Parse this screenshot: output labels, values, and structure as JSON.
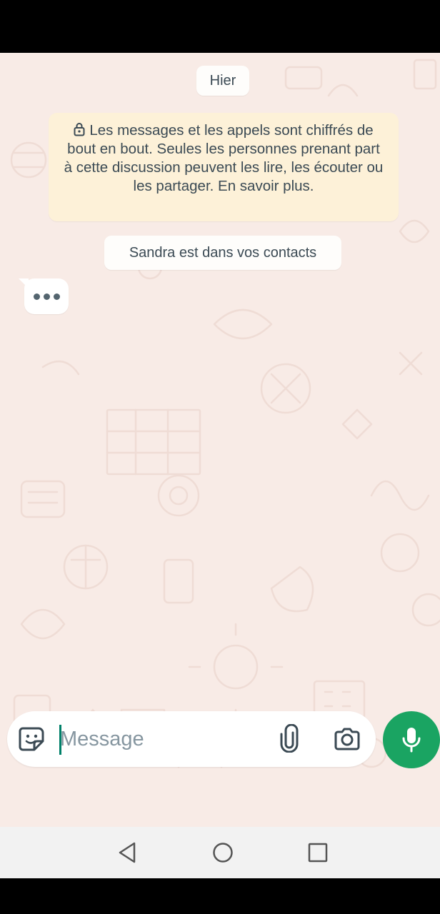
{
  "chat": {
    "date_separator": "Hier",
    "encryption_notice": "Les messages et les appels sont chiffrés de bout en bout. Seules les personnes prenant part à cette discussion peuvent les lire, les écouter ou les partager. En savoir plus.",
    "contact_notice": "Sandra est dans vos contacts",
    "typing_indicator": "•••"
  },
  "composer": {
    "placeholder": "Message"
  },
  "icons": {
    "lock": "lock-icon",
    "sticker": "sticker-icon",
    "attach": "paperclip-icon",
    "camera": "camera-icon",
    "mic": "microphone-icon",
    "back": "back-triangle-icon",
    "home": "home-circle-icon",
    "recent": "recent-apps-square-icon"
  },
  "colors": {
    "chat_background": "#f8ebe6",
    "system_notice": "#fdf1d8",
    "accent_green": "#1aa462",
    "caret": "#008069"
  }
}
